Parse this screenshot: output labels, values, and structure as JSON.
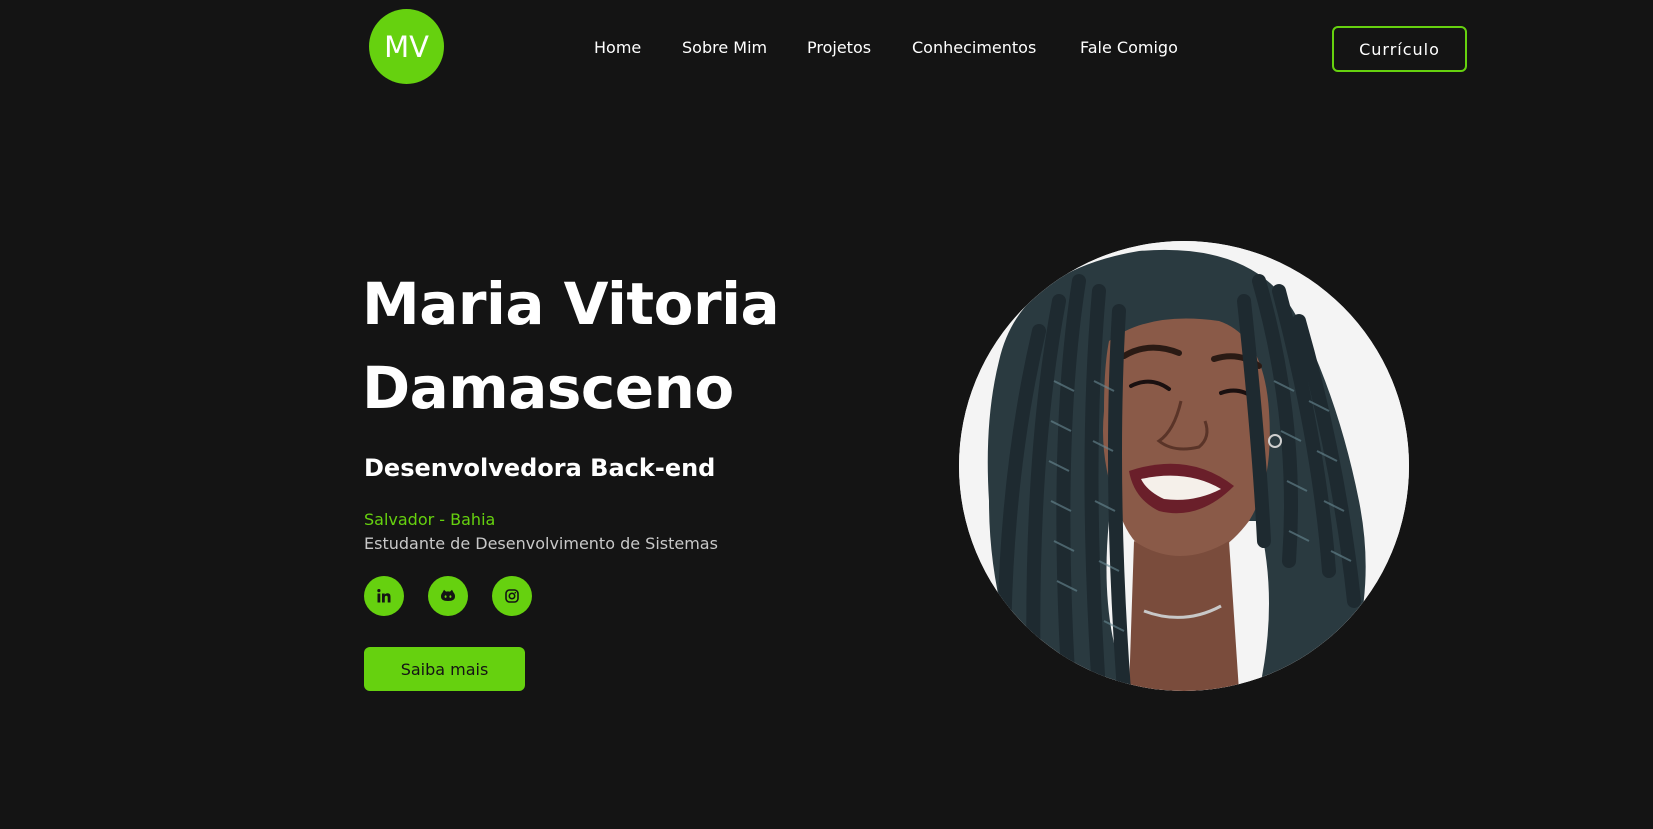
{
  "header": {
    "logo_text": "MV",
    "nav": [
      {
        "label": "Home"
      },
      {
        "label": "Sobre Mim"
      },
      {
        "label": "Projetos"
      },
      {
        "label": "Conhecimentos"
      },
      {
        "label": "Fale Comigo"
      }
    ],
    "cv_button_label": "Currículo"
  },
  "hero": {
    "name_line1": "Maria Vitoria",
    "name_line2": "Damasceno",
    "role": "Desenvolvedora Back-end",
    "location": "Salvador - Bahia",
    "description": "Estudante de Desenvolvimento de Sistemas",
    "social": [
      {
        "icon": "linkedin-icon"
      },
      {
        "icon": "github-icon"
      },
      {
        "icon": "instagram-icon"
      }
    ],
    "cta_label": "Saiba mais",
    "photo": "profile-photo"
  },
  "colors": {
    "background": "#141414",
    "accent": "#66d10f",
    "text": "#ffffff",
    "muted_text": "#c8c8c8"
  }
}
